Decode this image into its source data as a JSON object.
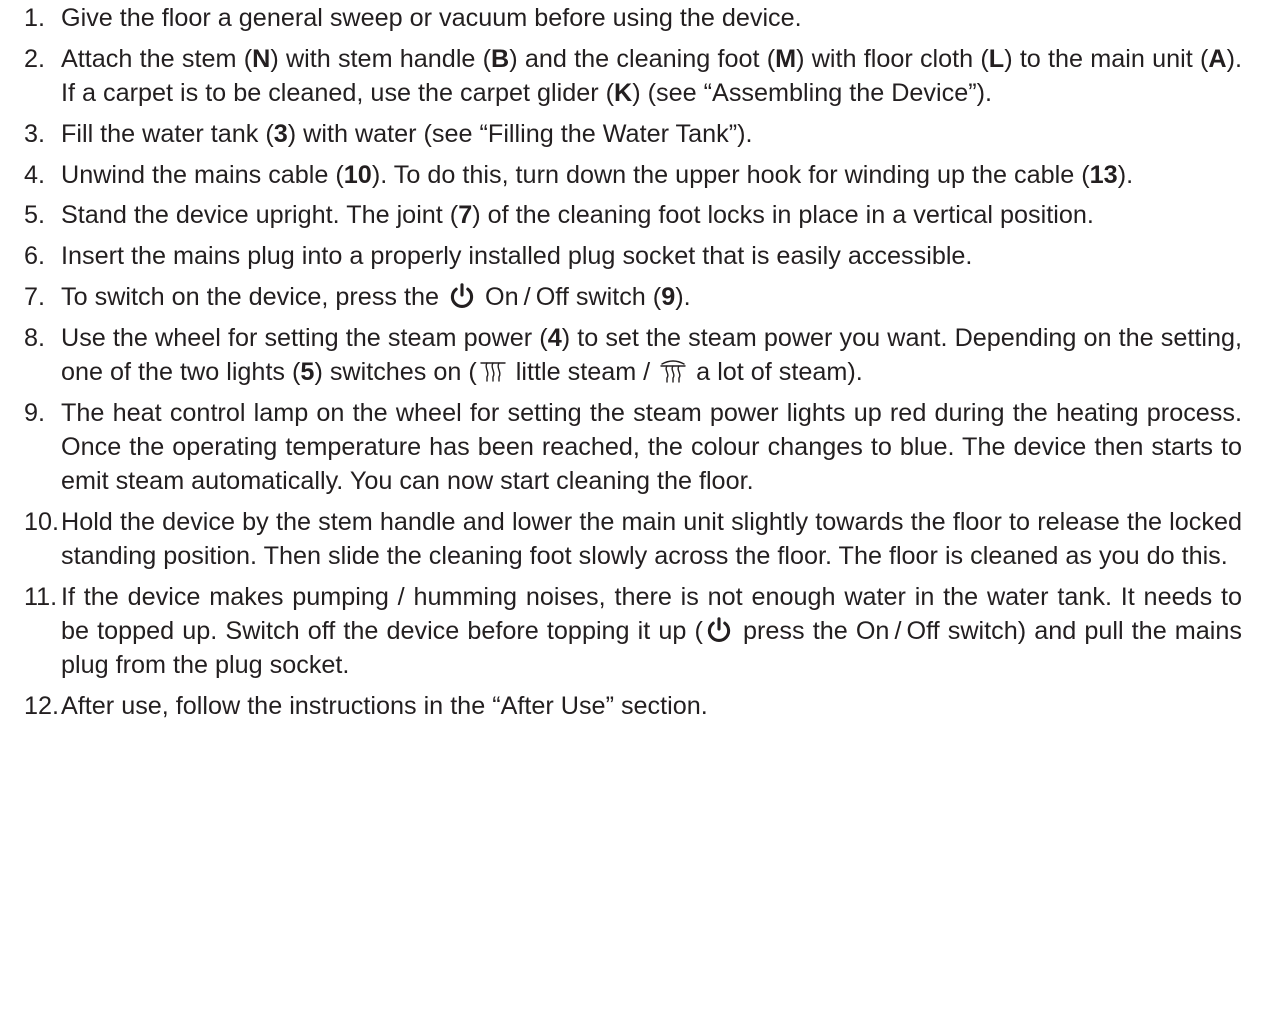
{
  "steps": [
    {
      "num": "1.",
      "parts": [
        {
          "t": "Give the floor a general sweep or vacuum before using the device."
        }
      ]
    },
    {
      "num": "2.",
      "parts": [
        {
          "t": "Attach the stem ("
        },
        {
          "t": "N",
          "b": true
        },
        {
          "t": ") with stem handle ("
        },
        {
          "t": "B",
          "b": true
        },
        {
          "t": ") and the cleaning foot ("
        },
        {
          "t": "M",
          "b": true
        },
        {
          "t": ") with floor cloth ("
        },
        {
          "t": "L",
          "b": true
        },
        {
          "t": ") to the main unit ("
        },
        {
          "t": "A",
          "b": true
        },
        {
          "t": "). If a carpet is to be cleaned, use the carpet glider ("
        },
        {
          "t": "K",
          "b": true
        },
        {
          "t": ") (see “As­sembling the Device”)."
        }
      ]
    },
    {
      "num": "3.",
      "parts": [
        {
          "t": "Fill the water tank ("
        },
        {
          "t": "3",
          "b": true
        },
        {
          "t": ") with water (see “Filling the Water Tank”)."
        }
      ]
    },
    {
      "num": "4.",
      "parts": [
        {
          "t": "Unwind the mains cable ("
        },
        {
          "t": "10",
          "b": true
        },
        {
          "t": "). To do this, turn down the upper hook for winding up the cable ("
        },
        {
          "t": "13",
          "b": true
        },
        {
          "t": ")."
        }
      ]
    },
    {
      "num": "5.",
      "parts": [
        {
          "t": "Stand the device upright. The joint ("
        },
        {
          "t": "7",
          "b": true
        },
        {
          "t": ") of the cleaning foot locks in place in a vertical position."
        }
      ]
    },
    {
      "num": "6.",
      "parts": [
        {
          "t": "Insert the mains plug into a properly installed plug socket that is easily accessible."
        }
      ]
    },
    {
      "num": "7.",
      "parts": [
        {
          "t": "To switch on the device, press the "
        },
        {
          "icon": "power-icon"
        },
        {
          "t": " On / Off switch ("
        },
        {
          "t": "9",
          "b": true
        },
        {
          "t": ")."
        }
      ]
    },
    {
      "num": "8.",
      "parts": [
        {
          "t": "Use the wheel for setting the steam power ("
        },
        {
          "t": "4",
          "b": true
        },
        {
          "t": ") to set the steam power you want. De­pending on the setting, one of the two lights ("
        },
        {
          "t": "5",
          "b": true
        },
        {
          "t": ") switches on ("
        },
        {
          "icon": "steam-low-icon"
        },
        {
          "t": " little steam / "
        },
        {
          "icon": "steam-high-icon"
        },
        {
          "t": " a lot of steam)."
        }
      ]
    },
    {
      "num": "9.",
      "parts": [
        {
          "t": "The heat control lamp on the wheel for setting the steam power lights up red during the heating process. Once the operating temperature has been reached, the colour changes to blue. The device then starts to emit steam automatically. You can now start cleaning the floor."
        }
      ]
    },
    {
      "num": "10.",
      "parts": [
        {
          "t": "Hold the device by the stem handle and lower the main unit slightly towards the floor to release the locked standing position. Then slide the cleaning foot slowly across the floor. The floor is cleaned as you do this."
        }
      ]
    },
    {
      "num": "11.",
      "parts": [
        {
          "t": "If the device makes pumping / humming noises, there is not enough water in the wa­ter tank. It needs to be topped up. Switch off the device before topping it up ("
        },
        {
          "icon": "power-icon"
        },
        {
          "t": " press the On / Off switch) and pull the mains plug from the plug socket."
        }
      ]
    },
    {
      "num": "12.",
      "parts": [
        {
          "t": "After use, follow the instructions in the “After Use” section."
        }
      ]
    }
  ]
}
